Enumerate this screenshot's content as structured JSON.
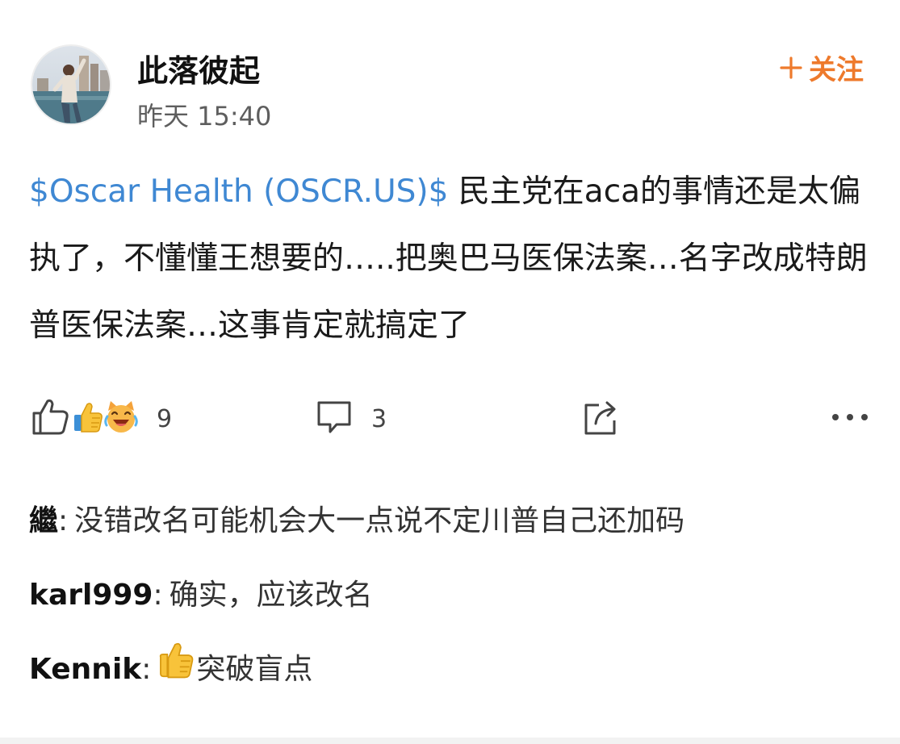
{
  "post": {
    "author": "此落彼起",
    "time": "昨天 15:40",
    "follow_label": "关注",
    "cashtag": "$Oscar Health (OSCR.US)$",
    "text": " 民主党在aca的事情还是太偏执了，不懂懂王想要的…..把奥巴马医保法案…名字改成特朗普医保法案…这事肯定就搞定了"
  },
  "actions": {
    "like_count": "9",
    "comment_count": "3"
  },
  "comments": [
    {
      "name": "繼",
      "text": "没错改名可能机会大一点说不定川普自己还加码"
    },
    {
      "name": "karl999",
      "text": "确实，应该改名"
    },
    {
      "name": "Kennik",
      "text": "突破盲点"
    }
  ],
  "colors": {
    "accent": "#ee7a2c",
    "link": "#3f88d3"
  },
  "icons": {
    "follow": "plus-icon",
    "like": "thumbs-up-outline-icon",
    "reactions": [
      "thumbs-up-emoji-icon",
      "laughing-cat-emoji-icon"
    ],
    "comment": "comment-bubble-icon",
    "share": "share-icon",
    "more": "more-dots-icon"
  }
}
